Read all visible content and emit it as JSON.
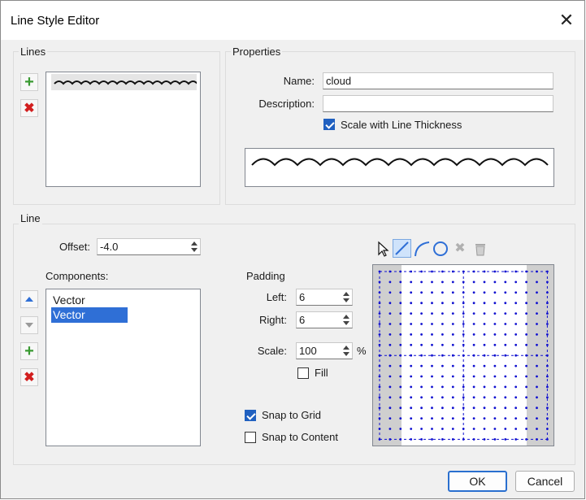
{
  "dialog": {
    "title": "Line Style Editor"
  },
  "lines": {
    "group_label": "Lines"
  },
  "properties": {
    "group_label": "Properties",
    "name_label": "Name:",
    "name_value": "cloud",
    "description_label": "Description:",
    "description_value": "",
    "scale_label": "Scale with Line Thickness",
    "scale_checked": true
  },
  "line": {
    "group_label": "Line",
    "offset_label": "Offset:",
    "offset_value": "-4.0",
    "components_label": "Components:",
    "components": [
      "Vector",
      "Vector"
    ],
    "selected_index": 1,
    "padding_label": "Padding",
    "left_label": "Left:",
    "left_value": "6",
    "right_label": "Right:",
    "right_value": "6",
    "scale_label": "Scale:",
    "scale_value": "100",
    "scale_unit": "%",
    "fill_label": "Fill",
    "fill_checked": false,
    "snap_grid_label": "Snap to Grid",
    "snap_grid_checked": true,
    "snap_content_label": "Snap to Content",
    "snap_content_checked": false
  },
  "tools": [
    "select-tool",
    "line-tool",
    "arc-tool",
    "circle-tool",
    "delete-tool",
    "clear-tool"
  ],
  "footer": {
    "ok": "OK",
    "cancel": "Cancel"
  },
  "colors": {
    "accent": "#2f6fd6",
    "grid_dot": "#1010d0"
  }
}
